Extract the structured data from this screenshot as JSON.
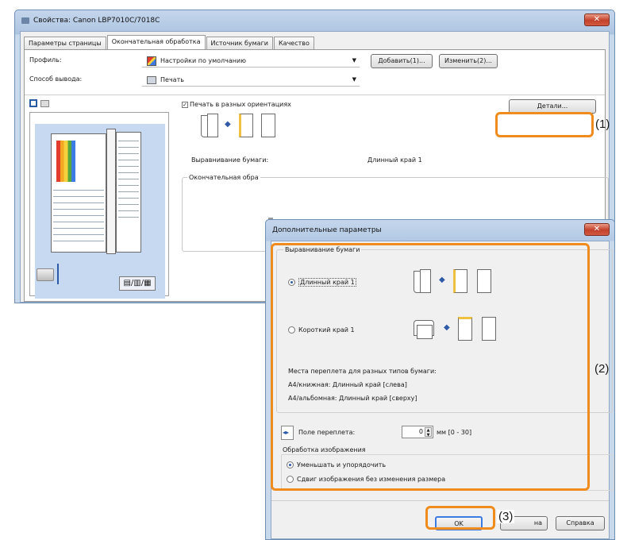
{
  "main_window": {
    "title": "Свойства: Canon LBP7010C/7018C",
    "close_label": "✕",
    "tabs": [
      "Параметры страницы",
      "Окончательная обработка",
      "Источник бумаги",
      "Качество"
    ],
    "profile_label": "Профиль:",
    "profile_value": "Настройки по умолчанию",
    "add_button": "Добавить(1)...",
    "edit_button": "Изменить(2)...",
    "output_label": "Способ вывода:",
    "output_value": "Печать",
    "mixed_orientation_label": "Печать в разных ориентациях",
    "details_button": "Детали...",
    "paper_alignment_label": "Выравнивание бумаги:",
    "paper_alignment_value": "Длинный край 1",
    "finishing_group_label": "Окончательная обра"
  },
  "dialog": {
    "title": "Дополнительные параметры",
    "close_label": "✕",
    "group_paper_alignment": "Выравнивание бумаги",
    "radio_long_edge": "Длинный край 1",
    "radio_short_edge": "Короткий край 1",
    "binding_info_title": "Места переплета для разных типов бумаги:",
    "binding_info_a4_portrait": "А4/книжная: Длинный край [слева]",
    "binding_info_a4_landscape": "А4/альбомная: Длинный край [сверху]",
    "gutter_label": "Поле переплета:",
    "gutter_value": "0",
    "gutter_unit": "мм [0 - 30]",
    "image_processing_label": "Обработка изображения",
    "radio_reduce": "Уменьшать и упорядочить",
    "radio_shift": "Сдвиг изображения без изменения размера",
    "ok_button": "OK",
    "cancel_button_partial": "на",
    "help_button": "Справка"
  },
  "callouts": [
    "(1)",
    "(2)",
    "(3)"
  ],
  "colors": {
    "highlight": "#f08c1e",
    "accent": "#2b5aa8"
  }
}
